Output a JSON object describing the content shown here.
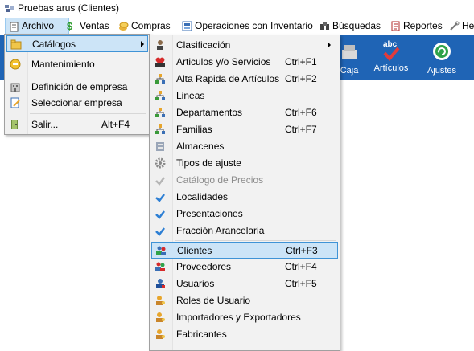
{
  "window": {
    "title": "Pruebas arus (Clientes)"
  },
  "menubar": {
    "items": [
      {
        "label": "Archivo"
      },
      {
        "label": "Ventas"
      },
      {
        "label": "Compras"
      },
      {
        "label": "Operaciones con Inventario"
      },
      {
        "label": "Búsquedas"
      },
      {
        "label": "Reportes"
      },
      {
        "label": "He"
      }
    ]
  },
  "toolbar": {
    "buttons": [
      {
        "label": "Caja"
      },
      {
        "label": "Artículos",
        "icon_text": "abc"
      },
      {
        "label": "Ajustes"
      }
    ]
  },
  "archivo_menu": {
    "items": [
      {
        "label": "Catálogos",
        "shortcut": ""
      },
      {
        "label": "Mantenimiento",
        "shortcut": ""
      },
      {
        "label": "Definición de empresa",
        "shortcut": ""
      },
      {
        "label": "Seleccionar empresa",
        "shortcut": ""
      },
      {
        "label": "Salir...",
        "shortcut": "Alt+F4"
      }
    ]
  },
  "catalogos_menu": {
    "items": [
      {
        "label": "Clasificación",
        "shortcut": ""
      },
      {
        "label": "Articulos y/o Servicios",
        "shortcut": "Ctrl+F1"
      },
      {
        "label": "Alta Rapida de Artículos",
        "shortcut": "Ctrl+F2"
      },
      {
        "label": "Lineas",
        "shortcut": ""
      },
      {
        "label": "Departamentos",
        "shortcut": "Ctrl+F6"
      },
      {
        "label": "Familias",
        "shortcut": "Ctrl+F7"
      },
      {
        "label": "Almacenes",
        "shortcut": ""
      },
      {
        "label": "Tipos de ajuste",
        "shortcut": ""
      },
      {
        "label": "Catálogo de Precios",
        "shortcut": ""
      },
      {
        "label": "Localidades",
        "shortcut": ""
      },
      {
        "label": "Presentaciones",
        "shortcut": ""
      },
      {
        "label": "Fracción Arancelaria",
        "shortcut": ""
      },
      {
        "label": "Clientes",
        "shortcut": "Ctrl+F3"
      },
      {
        "label": "Proveedores",
        "shortcut": "Ctrl+F4"
      },
      {
        "label": "Usuarios",
        "shortcut": "Ctrl+F5"
      },
      {
        "label": "Roles de Usuario",
        "shortcut": ""
      },
      {
        "label": "Importadores y Exportadores",
        "shortcut": ""
      },
      {
        "label": "Fabricantes",
        "shortcut": ""
      }
    ]
  },
  "colors": {
    "toolbar": "#1f64b5",
    "highlight": "#cce4f7",
    "highlight_border": "#3f93d6",
    "menu_bg": "#f2f2f2"
  }
}
